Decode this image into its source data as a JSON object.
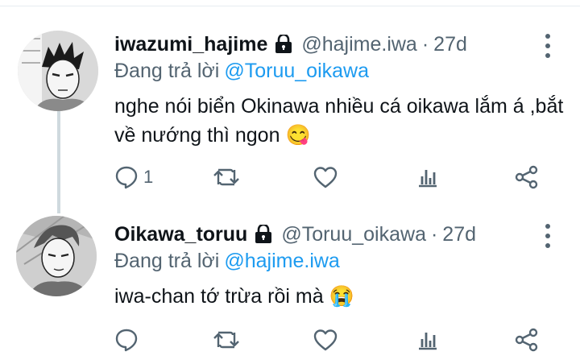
{
  "tweets": [
    {
      "name": "iwazumi_hajime",
      "handle": "@hajime.iwa",
      "time": "27d",
      "reply_prefix": "Đang trả lời",
      "reply_to": "@Toruu_oikawa",
      "text": "nghe nói biển Okinawa nhiều cá oikawa lắm á ,bắt về nướng thì ngon 😋",
      "reply_count": "1",
      "icons": [
        "reply-icon",
        "retweet-icon",
        "like-icon",
        "analytics-icon",
        "share-icon"
      ]
    },
    {
      "name": "Oikawa_toruu",
      "handle": "@Toruu_oikawa",
      "time": "27d",
      "reply_prefix": "Đang trả lời",
      "reply_to": "@hajime.iwa",
      "text": "iwa-chan tớ trừa rồi mà 😭",
      "reply_count": "",
      "icons": [
        "reply-icon",
        "retweet-icon",
        "like-icon",
        "analytics-icon",
        "share-icon"
      ]
    }
  ],
  "colors": {
    "text": "#0f1419",
    "muted": "#536471",
    "mention": "#1d9bf0",
    "thread_line": "#cfd9de"
  }
}
